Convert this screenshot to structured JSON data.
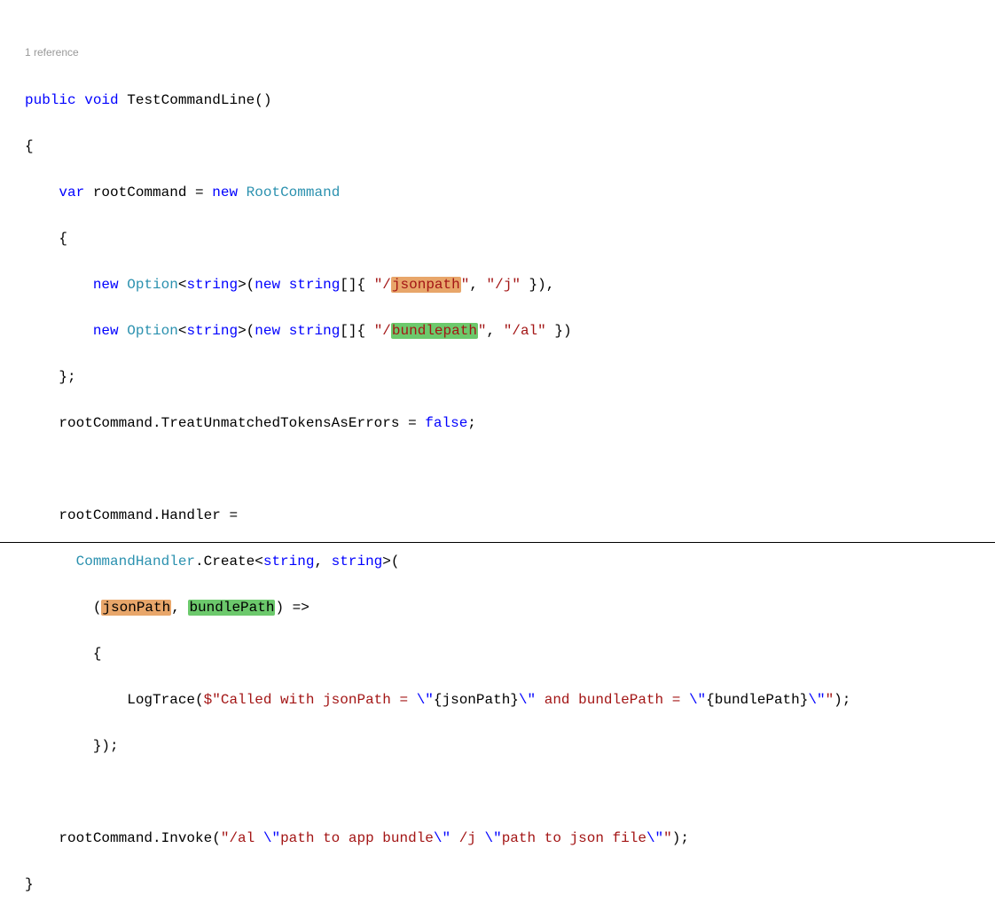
{
  "codelens": {
    "references": "1 reference"
  },
  "code": {
    "line1_public": "public",
    "line1_void": "void",
    "line1_method": "TestCommandLine",
    "line1_parens": "()",
    "line2": "{",
    "line3_var": "var",
    "line3_root": " rootCommand = ",
    "line3_new": "new",
    "line3_type": "RootCommand",
    "line4": "{",
    "line5_new": "new",
    "line5_option": "Option",
    "line5_string": "string",
    "line5_afteropt": ">(",
    "line5_new2": "new",
    "line5_string2": "string",
    "line5_brackets": "[]{ ",
    "line5_q1": "\"/",
    "line5_jsonpath": "jsonpath",
    "line5_q2": "\"",
    "line5_comma": ", ",
    "line5_j": "\"/j\"",
    "line5_end": " }),",
    "line6_new": "new",
    "line6_option": "Option",
    "line6_string": "string",
    "line6_afteropt": ">(",
    "line6_new2": "new",
    "line6_string2": "string",
    "line6_brackets": "[]{ ",
    "line6_q1": "\"/",
    "line6_bundlepath": "bundlepath",
    "line6_q2": "\"",
    "line6_comma": ", ",
    "line6_al": "\"/al\"",
    "line6_end": " })",
    "line7": "};",
    "line8_a": "rootCommand.TreatUnmatchedTokensAsErrors = ",
    "line8_false": "false",
    "line8_semi": ";",
    "line10": "rootCommand.Handler =",
    "line11_ch": "CommandHandler",
    "line11_create": ".Create<",
    "line11_s1": "string",
    "line11_c": ", ",
    "line11_s2": "string",
    "line11_end": ">(",
    "line12_open": "(",
    "line12_jp": "jsonPath",
    "line12_comma": ", ",
    "line12_bp": "bundlePath",
    "line12_close": ") =>",
    "line13": "{",
    "line14_a": "LogTrace(",
    "line14_dollar": "$\"Called with jsonPath = ",
    "line14_esc1": "\\\"",
    "line14_interp1a": "{jsonPath}",
    "line14_esc2": "\\\"",
    "line14_and": " and bundlePath = ",
    "line14_esc3": "\\\"",
    "line14_interp2a": "{bundlePath}",
    "line14_esc4": "\\\"",
    "line14_endq": "\"",
    "line14_close": ");",
    "line15": "});",
    "line17_a": "rootCommand.Invoke(",
    "line17_str": "\"/al ",
    "line17_esc1": "\\\"",
    "line17_p1": "path to app bundle",
    "line17_esc2": "\\\"",
    "line17_mid": " /j ",
    "line17_esc3": "\\\"",
    "line17_p2": "path to json file",
    "line17_esc4": "\\\"",
    "line17_endq": "\"",
    "line17_close": ");",
    "line18": "}"
  }
}
